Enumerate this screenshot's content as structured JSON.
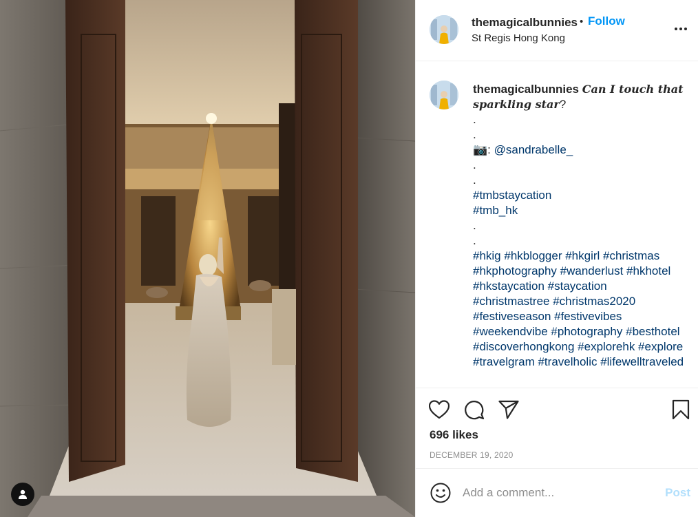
{
  "post": {
    "username": "themagicalbunnies",
    "separator": "•",
    "follow_label": "Follow",
    "location": "St Regis Hong Kong",
    "more_icon": "more-horizontal-icon",
    "tag_icon": "user-tag-icon"
  },
  "caption": {
    "username": "themagicalbunnies",
    "text_italic": "Can I touch that sparkling star",
    "text_end": "?",
    "dots": [
      ".",
      ".",
      ".",
      ".",
      ".",
      "."
    ],
    "camera_emoji": "📷",
    "credit_colon": ": ",
    "credit_handle": "@sandrabelle_",
    "tags_group1": [
      "#tmbstaycation",
      "#tmb_hk"
    ],
    "tags_group2": "#hkig #hkblogger #hkgirl #christmas #hkphotography #wanderlust #hkhotel #hkstaycation #staycation #christmastree #christmas2020 #festiveseason #festivevibes #weekendvibe #photography #besthotel #discoverhongkong #explorehk #explore #travelgram #travelholic #lifewelltraveled"
  },
  "actions": {
    "like_icon": "heart-icon",
    "comment_icon": "comment-icon",
    "share_icon": "share-icon",
    "save_icon": "bookmark-icon",
    "likes": "696 likes",
    "date": "DECEMBER 19, 2020"
  },
  "comment_bar": {
    "emoji_icon": "smiley-icon",
    "placeholder": "Add a comment...",
    "post_label": "Post",
    "post_color": "#b2dffc"
  },
  "colors": {
    "link": "#00376b",
    "follow": "#0095f6",
    "muted": "#8e8e8e"
  }
}
